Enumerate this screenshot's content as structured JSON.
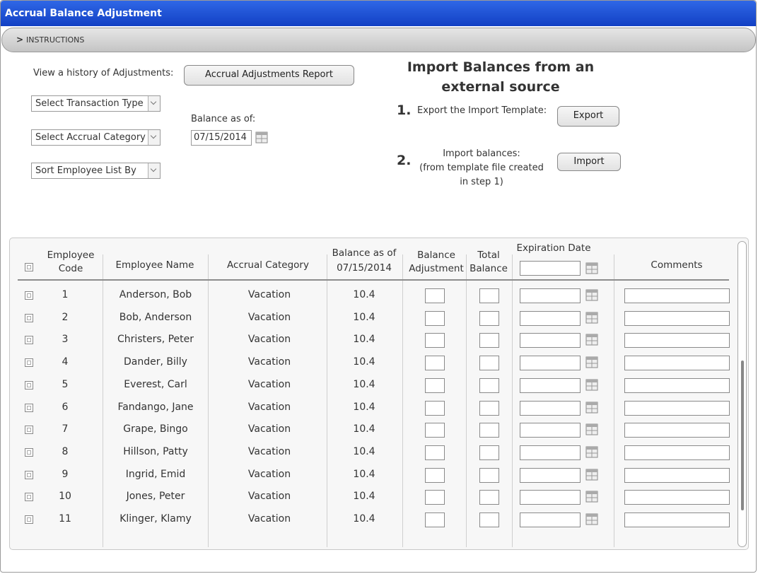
{
  "window": {
    "title": "Accrual Balance Adjustment"
  },
  "instructions": {
    "label": "INSTRUCTIONS"
  },
  "history": {
    "label": "View a history of Adjustments:",
    "button": "Accrual Adjustments Report"
  },
  "filters": {
    "transaction_type": "Select Transaction Type",
    "accrual_category": "Select Accrual Category",
    "sort_by": "Sort Employee List By"
  },
  "balance_as_of": {
    "label": "Balance as of:",
    "date": "07/15/2014"
  },
  "import": {
    "heading_line1": "Import Balances from an",
    "heading_line2": "external source",
    "step1": {
      "number": "1.",
      "label": "Export the Import Template:",
      "button": "Export"
    },
    "step2": {
      "number": "2.",
      "label_line1": "Import balances:",
      "label_line2": "(from template file created",
      "label_line3": "in step 1)",
      "button": "Import"
    }
  },
  "table": {
    "headers": {
      "employee_code_1": "Employee",
      "employee_code_2": "Code",
      "employee_name": "Employee Name",
      "accrual_category": "Accrual Category",
      "balance_as_of_1": "Balance as of",
      "balance_as_of_2": "07/15/2014",
      "balance_adjustment_1": "Balance",
      "balance_adjustment_2": "Adjustment",
      "total_balance_1": "Total",
      "total_balance_2": "Balance",
      "expiration_date": "Expiration Date",
      "comments": "Comments"
    },
    "rows": [
      {
        "code": "1",
        "name": "Anderson, Bob",
        "category": "Vacation",
        "balance": "10.4"
      },
      {
        "code": "2",
        "name": "Bob, Anderson",
        "category": "Vacation",
        "balance": "10.4"
      },
      {
        "code": "3",
        "name": "Christers, Peter",
        "category": "Vacation",
        "balance": "10.4"
      },
      {
        "code": "4",
        "name": "Dander, Billy",
        "category": "Vacation",
        "balance": "10.4"
      },
      {
        "code": "5",
        "name": "Everest, Carl",
        "category": "Vacation",
        "balance": "10.4"
      },
      {
        "code": "6",
        "name": "Fandango, Jane",
        "category": "Vacation",
        "balance": "10.4"
      },
      {
        "code": "7",
        "name": "Grape, Bingo",
        "category": "Vacation",
        "balance": "10.4"
      },
      {
        "code": "8",
        "name": "Hillson, Patty",
        "category": "Vacation",
        "balance": "10.4"
      },
      {
        "code": "9",
        "name": "Ingrid, Emid",
        "category": "Vacation",
        "balance": "10.4"
      },
      {
        "code": "10",
        "name": "Jones, Peter",
        "category": "Vacation",
        "balance": "10.4"
      },
      {
        "code": "11",
        "name": "Klinger, Klamy",
        "category": "Vacation",
        "balance": "10.4"
      }
    ]
  },
  "icons": {
    "calendar": "calendar-icon",
    "chevron": "chevron-right-icon",
    "dropdown": "chevron-down-icon"
  },
  "colors": {
    "title_bar": "#1f52d8"
  }
}
